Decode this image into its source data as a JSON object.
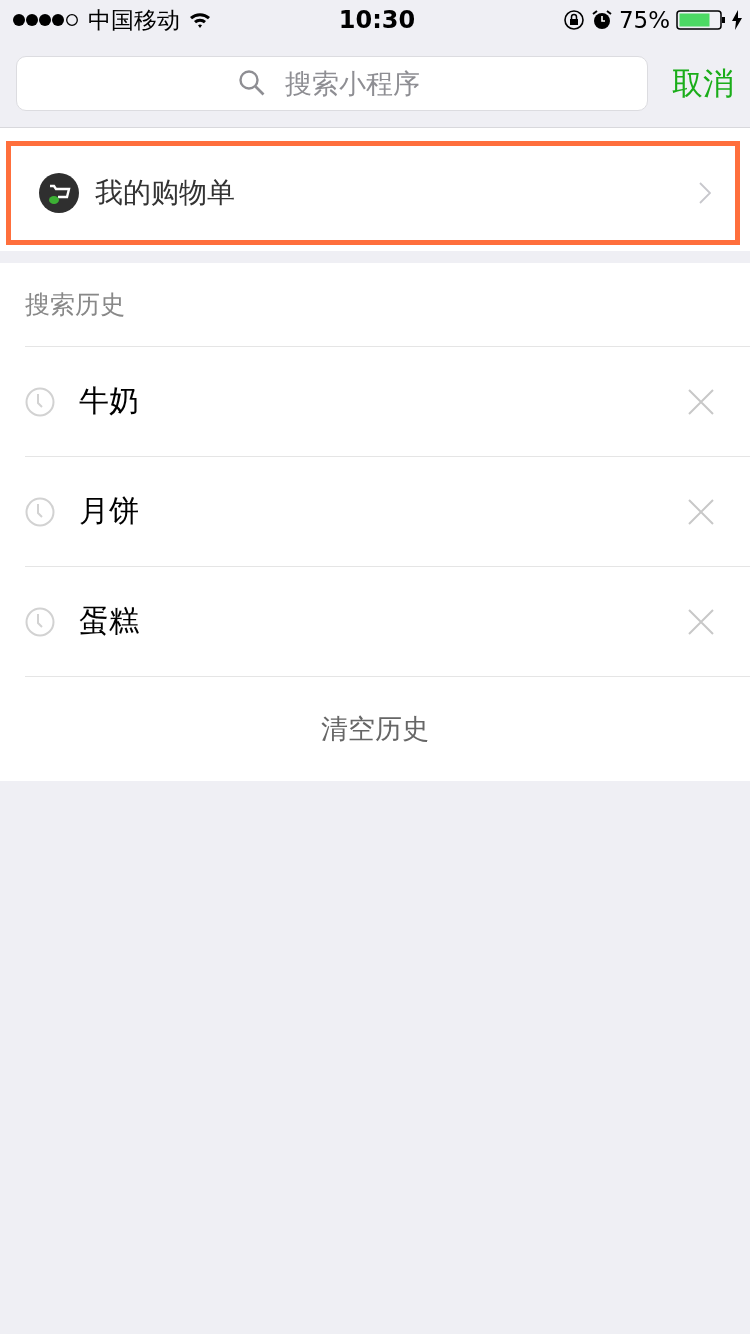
{
  "status_bar": {
    "carrier": "中国移动",
    "time": "10:30",
    "battery": "75%"
  },
  "search": {
    "placeholder": "搜索小程序",
    "cancel": "取消"
  },
  "result": {
    "title": "我的购物单",
    "highlighted": true
  },
  "history": {
    "title": "搜索历史",
    "items": [
      {
        "text": "牛奶"
      },
      {
        "text": "月饼"
      },
      {
        "text": "蛋糕"
      }
    ],
    "clear": "清空历史"
  }
}
